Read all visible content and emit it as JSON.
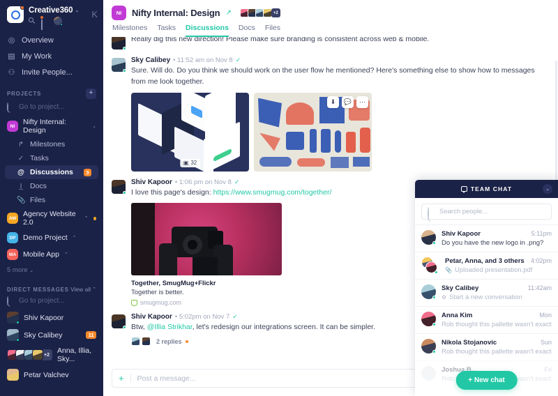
{
  "workspace": {
    "name": "Creative360",
    "logo_icon": "camera-ring-logo",
    "caret_icon": "chevron-down-icon",
    "search_icon": "search-icon",
    "notifications_icon": "bell-icon",
    "avatar_icon": "user-avatar",
    "collapse_icon": "collapse-sidebar-icon",
    "collapse_glyph": "K"
  },
  "sidebar": {
    "nav": [
      {
        "label": "Overview",
        "icon": "compass-icon",
        "glyph": "◎"
      },
      {
        "label": "My Work",
        "icon": "calendar-icon",
        "glyph": "▤"
      },
      {
        "label": "Invite People...",
        "icon": "add-person-icon",
        "glyph": "⚇"
      }
    ],
    "projects_section": {
      "title": "PROJECTS",
      "add_glyph": "+",
      "search_placeholder": "Go to project...",
      "items": [
        {
          "label": "Nifty Internal: Design",
          "initials": "NI",
          "color": "#c23ad6",
          "expanded": true,
          "caret": "⌄"
        },
        {
          "label": "Agency Website 2.0",
          "initials": "AW",
          "color": "#f5a623",
          "expanded": false,
          "caret": "⌃",
          "dot": true
        },
        {
          "label": "Demo Project",
          "initials": "DP",
          "color": "#44b3e8",
          "expanded": false,
          "caret": "⌃"
        },
        {
          "label": "Mobile App",
          "initials": "MA",
          "color": "#f5635b",
          "expanded": false,
          "caret": "⌃"
        }
      ],
      "sub_items": [
        {
          "label": "Milestones",
          "icon": "milestone-arrow-icon",
          "glyph": "↱",
          "active": false
        },
        {
          "label": "Tasks",
          "icon": "check-icon",
          "glyph": "✓",
          "active": false
        },
        {
          "label": "Discussions",
          "icon": "at-sign-icon",
          "glyph": "@",
          "active": true,
          "badge": "3"
        },
        {
          "label": "Docs",
          "icon": "document-text-icon",
          "glyph": "I̲",
          "active": false
        },
        {
          "label": "Files",
          "icon": "paperclip-icon",
          "glyph": "🖈",
          "active": false
        }
      ],
      "more_label": "5 more",
      "more_caret": "⌄"
    },
    "dm_section": {
      "title": "DIRECT MESSAGES",
      "view_all": "View all",
      "view_all_caret": "⌃",
      "search_placeholder": "Go to project...",
      "items": [
        {
          "label": "Shiv Kapoor",
          "type": "person",
          "online": true
        },
        {
          "label": "Sky Calibey",
          "type": "person",
          "online": true,
          "badge": "11"
        },
        {
          "label": "Anna, Illia, Sky...",
          "type": "group",
          "extra": "+2"
        },
        {
          "label": "Petar Valchev",
          "type": "person",
          "online": false
        }
      ]
    }
  },
  "header": {
    "project_initials": "NI",
    "project_color": "#c23ad6",
    "title": "Nifty Internal: Design",
    "link_icon": "share-link-icon",
    "members_extra": "+2",
    "tabs": [
      {
        "label": "Milestones",
        "active": false
      },
      {
        "label": "Tasks",
        "active": false
      },
      {
        "label": "Discussions",
        "active": true
      },
      {
        "label": "Docs",
        "active": false
      },
      {
        "label": "Files",
        "active": false
      }
    ]
  },
  "feed": {
    "messages": [
      {
        "id": "m0",
        "partial": true,
        "text": "Really dig this new direction! Please make sure branding is consistent across web & mobile."
      },
      {
        "id": "m1",
        "author": "Sky Calibey",
        "time": "11:52 am on Nov 8",
        "check_icon": "sent-check-icon",
        "text": "Sure. Will do. Do you think we should work on the user flow he mentioned? Here's something else to show how to messages from me look together.",
        "attachments": [
          {
            "name": "isometric-ui-mockup",
            "count_badge": "32",
            "count_icon": "images-icon"
          },
          {
            "name": "illustration-poster-pattern",
            "tools": [
              "download-icon",
              "comment-icon",
              "more-icon"
            ]
          }
        ]
      },
      {
        "id": "m2",
        "author": "Shiv Kapoor",
        "time": "1:06 pm on Nov 8",
        "check_icon": "sent-check-icon",
        "text_prefix": "I love this page's design: ",
        "link_text": "https://www.smugmug.com/together/",
        "link_card": {
          "image_name": "photographer-with-camera-photo",
          "title": "Together, SmugMug+Flickr",
          "subtitle": "Together is better.",
          "source": "smugmug.com",
          "favicon": "smugmug-favicon"
        }
      },
      {
        "id": "m3",
        "author": "Shiv Kapoor",
        "time": "5:02pm on Nov 7",
        "check_icon": "sent-check-icon",
        "text_prefix": "Btw, ",
        "mention": "@Illia Strikhar",
        "text_suffix": ", let's redesign our integrations screen. It can be simpler.",
        "replies_label": "2 replies",
        "replies_dot": true
      }
    ]
  },
  "composer": {
    "plus_icon": "add-attachment-icon",
    "plus_glyph": "+",
    "placeholder": "Post a message...",
    "value": ""
  },
  "team_chat": {
    "title": "TEAM CHAT",
    "bubble_icon": "chat-bubble-icon",
    "toggle_icon": "chevron-down-icon",
    "toggle_glyph": "⌄",
    "search_placeholder": "Search people...",
    "search_value": "",
    "new_chat_label": "+ New chat",
    "accent_color": "#22c8a5",
    "header_color": "#1b2247",
    "conversations": [
      {
        "name": "Shiv Kapoor",
        "time": "5:11pm",
        "preview": "Do you have the new logo in .png?",
        "avatar": "v1",
        "online": true,
        "muted": false
      },
      {
        "name": "Petar, Anna, and 3 others",
        "time": "4:02pm",
        "preview": "Uploaded presentation.pdf",
        "avatar": "group",
        "online": true,
        "muted": true,
        "prefix_icon": "paperclip-icon"
      },
      {
        "name": "Sky Calibey",
        "time": "11:42am",
        "preview": "Start a new conversation",
        "avatar": "v3",
        "online": true,
        "muted": true,
        "prefix_icon": "new-conversation-icon"
      },
      {
        "name": "Anna Kim",
        "time": "Mon",
        "preview": "Rob thought this pallette wasn't exactly w...",
        "avatar": "v4",
        "online": true,
        "muted": true
      },
      {
        "name": "Nikola Stojanovic",
        "time": "Sun",
        "preview": "Rob thought this pallette wasn't exactly w...",
        "avatar": "v5",
        "online": true,
        "muted": true
      },
      {
        "name": "Joshua B...",
        "time": "Fri",
        "preview": "Rob thought this pallette wasn't exactly w...",
        "avatar": "v6",
        "online": false,
        "muted": true,
        "faded": true
      }
    ]
  }
}
